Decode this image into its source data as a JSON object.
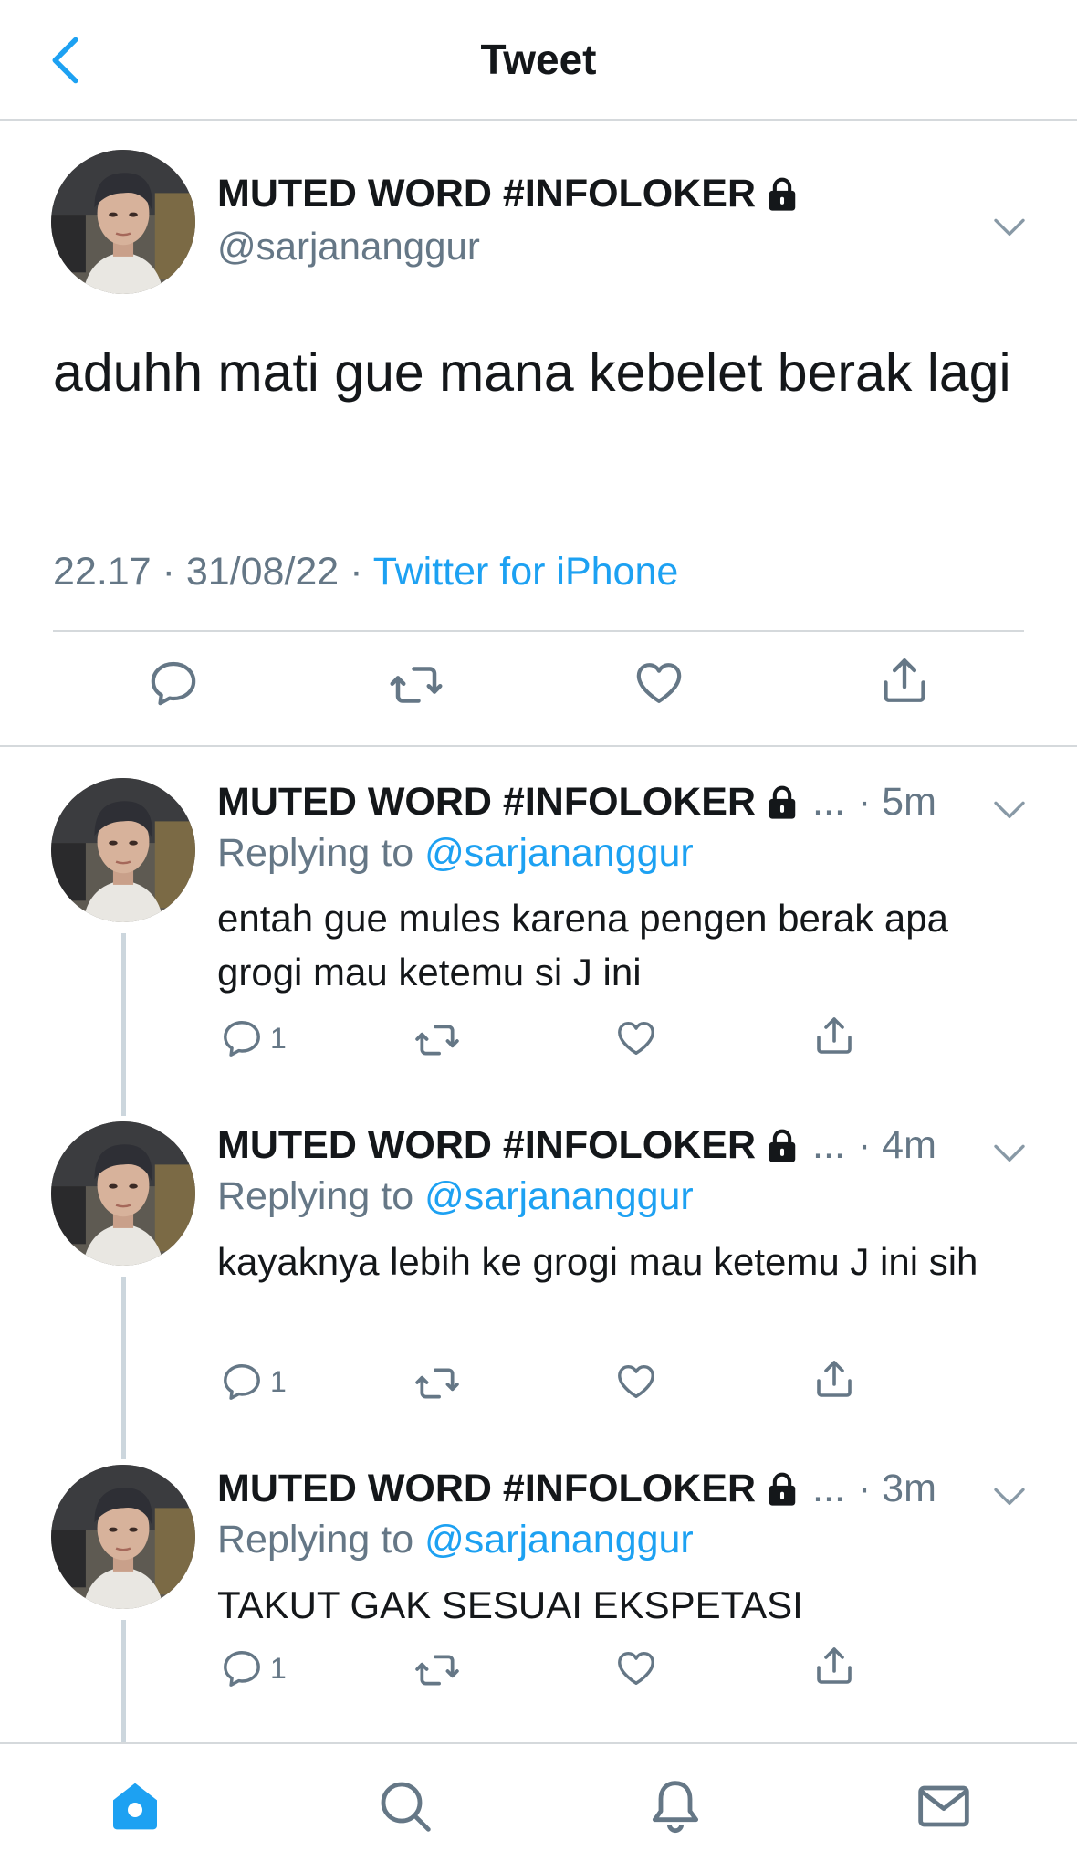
{
  "header": {
    "title": "Tweet"
  },
  "main_tweet": {
    "display_name": "MUTED WORD #INFOLOKER",
    "handle": "@sarjananggur",
    "text": "aduhh mati gue mana kebelet berak lagi",
    "time": "22.17",
    "date": "31/08/22",
    "source": "Twitter for iPhone"
  },
  "replies": [
    {
      "display_name": "MUTED WORD #INFOLOKER",
      "ellipsis": "...",
      "time": "· 5m",
      "replying_prefix": "Replying to",
      "replying_handle": "@sarjananggur",
      "text": "entah gue mules karena pengen berak apa grogi mau ketemu si J ini",
      "reply_count": "1"
    },
    {
      "display_name": "MUTED WORD #INFOLOKER",
      "ellipsis": "...",
      "time": "· 4m",
      "replying_prefix": "Replying to",
      "replying_handle": "@sarjananggur",
      "text": "kayaknya lebih ke grogi mau ketemu J ini sih",
      "reply_count": "1"
    },
    {
      "display_name": "MUTED WORD #INFOLOKER",
      "ellipsis": "...",
      "time": "· 3m",
      "replying_prefix": "Replying to",
      "replying_handle": "@sarjananggur",
      "text": "TAKUT GAK SESUAI EKSPETASI",
      "reply_count": "1"
    }
  ],
  "icons": {
    "back": "chevron-left-icon",
    "lock": "lock-icon",
    "caret": "chevron-down-icon",
    "reply": "reply-icon",
    "retweet": "retweet-icon",
    "like": "heart-icon",
    "share": "share-icon",
    "nav": [
      "home-icon",
      "search-icon",
      "notifications-icon",
      "messages-icon"
    ]
  },
  "colors": {
    "accent": "#1da1f2",
    "secondary_text": "#657786",
    "primary_text": "#14171a",
    "divider": "#d5d9dc",
    "thread_line": "#ccd6dd"
  }
}
